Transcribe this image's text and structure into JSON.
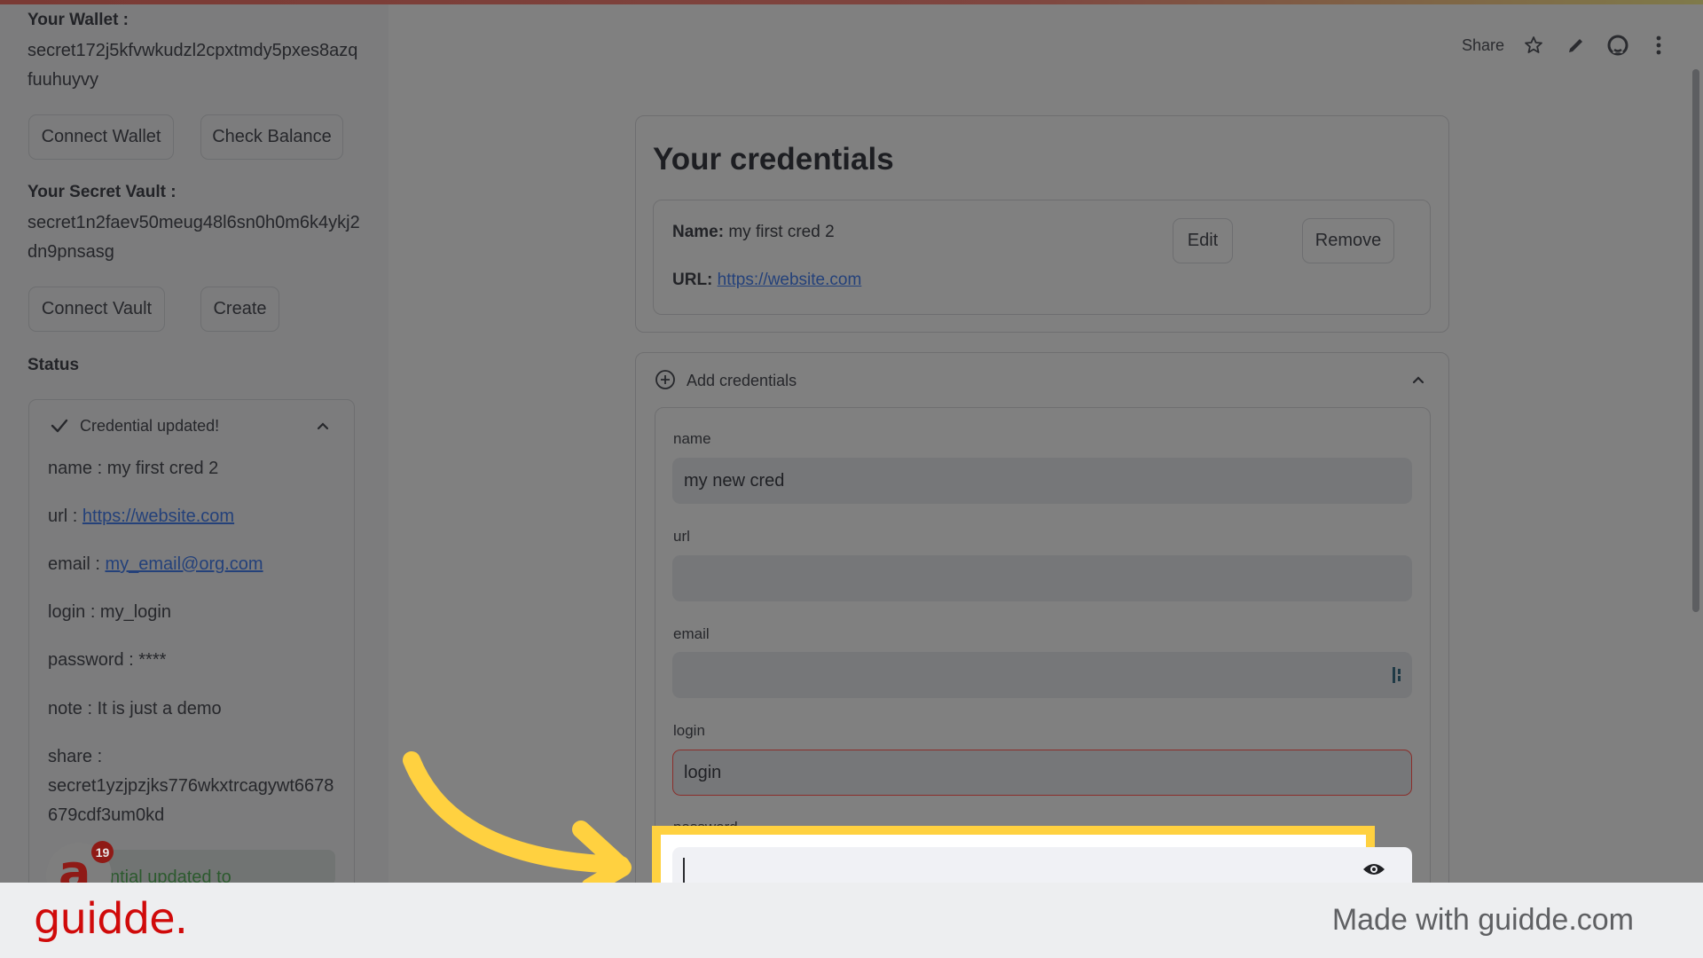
{
  "sidebar": {
    "wallet_heading": "Your Wallet :",
    "wallet_address_line1": "secret172j5kfvwkudzl2cpxtmdy5pxes8azq",
    "wallet_address_line2": "fuuhuyvy",
    "connect_wallet_label": "Connect Wallet",
    "check_balance_label": "Check Balance",
    "vault_heading": "Your Secret Vault :",
    "vault_address_line1": "secret1n2faev50meug48l6sn0h0m6k4ykj2",
    "vault_address_line2": "dn9pnsasg",
    "connect_vault_label": "Connect Vault",
    "create_label": "Create",
    "status_heading": "Status",
    "status": {
      "title": "Credential updated!",
      "name_line": "name : my first cred 2",
      "url_prefix": "url : ",
      "url_link": "https://website.com",
      "email_prefix": "email : ",
      "email_link": "my_email@org.com",
      "login_line": "login : my_login",
      "password_line": "password : ****",
      "note_line": "note : It is just a demo",
      "share_label": "share :",
      "share_line1": "secret1yzjpzjks776wkxtrcagywt6678",
      "share_line2": "679cdf3um0kd",
      "toast_partial": "ntial updated to"
    },
    "notification_badge_count": "19"
  },
  "toolbar": {
    "share_label": "Share",
    "icons": [
      "star-icon",
      "pencil-icon",
      "github-icon",
      "more-vertical-icon"
    ]
  },
  "credentials": {
    "title": "Your credentials",
    "items": [
      {
        "name_label": "Name:",
        "name_value": " my first cred 2",
        "url_label": "URL:",
        "url_value": "https://website.com",
        "edit_label": "Edit",
        "remove_label": "Remove"
      }
    ]
  },
  "add_form": {
    "expander_label": "Add credentials",
    "fields": {
      "name": {
        "label": "name",
        "value": "my new cred"
      },
      "url": {
        "label": "url",
        "value": ""
      },
      "email": {
        "label": "email",
        "value": ""
      },
      "login": {
        "label": "login",
        "value": "login"
      },
      "password": {
        "label": "password",
        "value": ""
      }
    }
  },
  "footer": {
    "brand": "guidde.",
    "made_with": "Made with guidde.com"
  },
  "colors": {
    "highlight": "#ffd140",
    "brand_red": "#d00a0a",
    "link": "#24417a",
    "error_border": "#8a2e2a"
  }
}
